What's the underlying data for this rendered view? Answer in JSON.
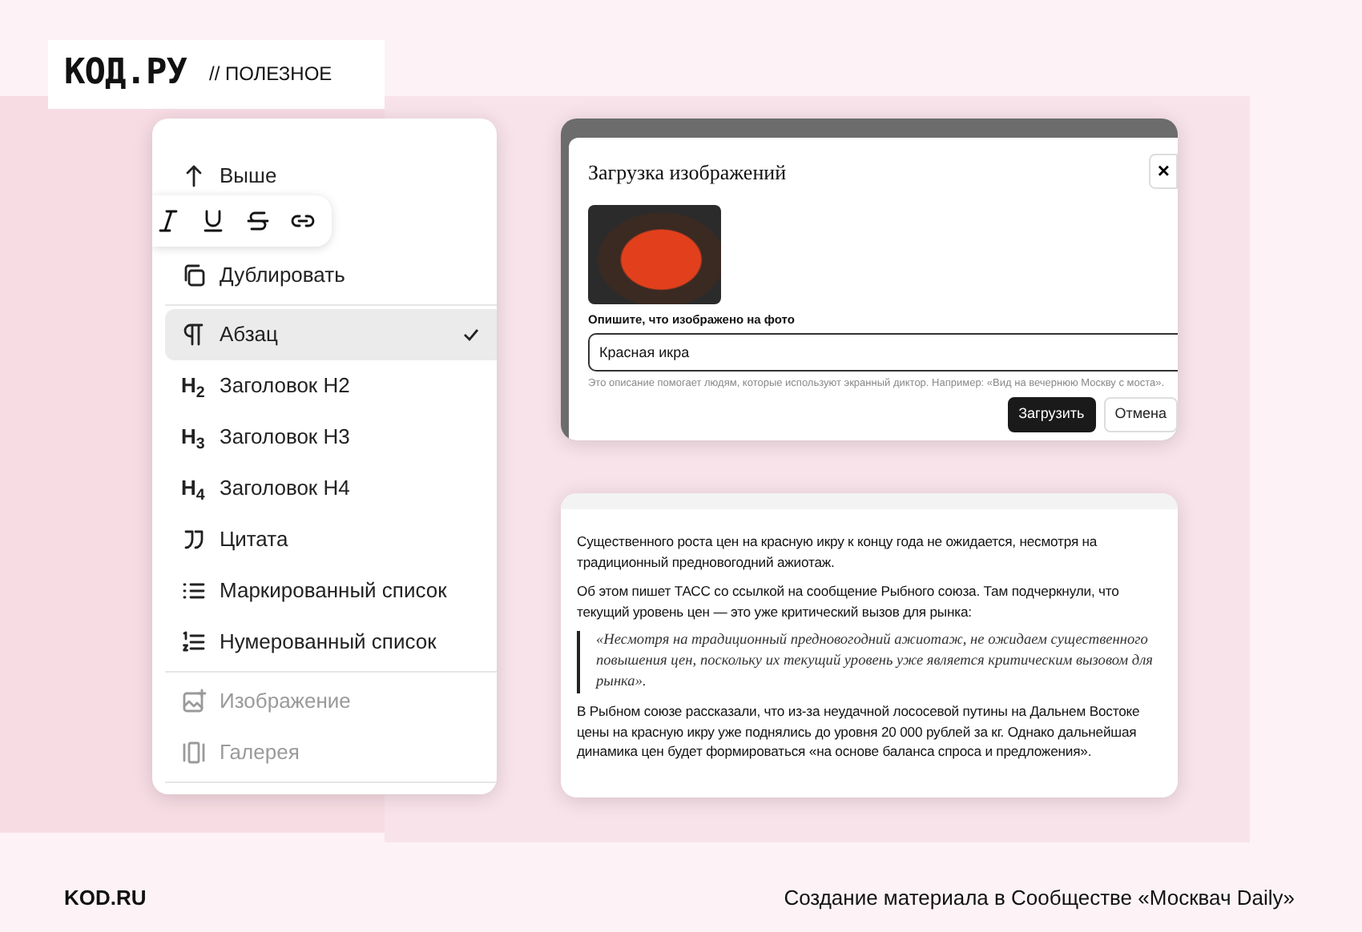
{
  "header": {
    "logo": "КОД.РУ",
    "section": "// ПОЛЕЗНОЕ"
  },
  "block_menu": {
    "items": [
      {
        "kind": "up",
        "label": "Выше",
        "selected": false,
        "disabled": false,
        "divider_after": false
      },
      {
        "kind": "duplicate",
        "label": "Дублировать",
        "selected": false,
        "disabled": false,
        "divider_after": true
      },
      {
        "kind": "paragraph",
        "label": "Абзац",
        "selected": true,
        "disabled": false,
        "divider_after": false
      },
      {
        "kind": "heading",
        "badge": "H$_{2}$",
        "label": "Заголовок H2",
        "selected": false,
        "disabled": false,
        "divider_after": false
      },
      {
        "kind": "heading",
        "badge": "H$_{3}$",
        "label": "Заголовок H3",
        "selected": false,
        "disabled": false,
        "divider_after": false
      },
      {
        "kind": "heading",
        "badge": "H$_{4}$",
        "label": "Заголовок H4",
        "selected": false,
        "disabled": false,
        "divider_after": false
      },
      {
        "kind": "quote",
        "label": "Цитата",
        "selected": false,
        "disabled": false,
        "divider_after": false
      },
      {
        "kind": "bullets",
        "label": "Маркированный список",
        "selected": false,
        "disabled": false,
        "divider_after": false
      },
      {
        "kind": "numbers",
        "label": "Нумерованный список",
        "selected": false,
        "disabled": false,
        "divider_after": true
      },
      {
        "kind": "image",
        "label": "Изображение",
        "selected": false,
        "disabled": true,
        "divider_after": false
      },
      {
        "kind": "gallery",
        "label": "Галерея",
        "selected": false,
        "disabled": true,
        "divider_after": true
      }
    ],
    "format_toolbar": [
      {
        "kind": "italic"
      },
      {
        "kind": "underline"
      },
      {
        "kind": "strike"
      },
      {
        "kind": "link"
      }
    ]
  },
  "upload_dialog": {
    "title": "Загрузка изображений",
    "close": "×",
    "field_label": "Опишите, что изображено на фото",
    "value": "Красная икра",
    "hint": "Это описание помогает людям, которые используют экранный диктор. Например: «Вид на вечернюю Москву с моста».",
    "buttons": [
      {
        "label": "Загрузить",
        "primary": true
      },
      {
        "label": "Отмена",
        "primary": false
      }
    ]
  },
  "article": {
    "blocks": [
      {
        "kind": "p",
        "text": "Существенного роста цен на красную икру к концу года не ожидается, несмотря на традиционный предновогодний ажиотаж."
      },
      {
        "kind": "p",
        "text": "Об этом пишет ТАСС со ссылкой на сообщение Рыбного союза. Там подчеркнули, что текущий уровень цен — это уже критический вызов для рынка:"
      },
      {
        "kind": "quote",
        "text": "«Несмотря на традиционный предновогодний ажиотаж, не ожидаем существенного повышения цен, поскольку их текущий уровень уже является критическим вызовом для рынка»."
      },
      {
        "kind": "p",
        "text": "В Рыбном союзе рассказали, что из-за неудачной лососевой путины на Дальнем Востоке цены на красную икру уже поднялись до уровня 20 000 рублей за кг. Однако дальнейшая динамика цен будет формироваться «на основе баланса спроса и предложения»."
      }
    ]
  },
  "footer": {
    "brand": "KOD.RU",
    "caption": "Создание материала в Сообществе «Москвач Daily»"
  }
}
